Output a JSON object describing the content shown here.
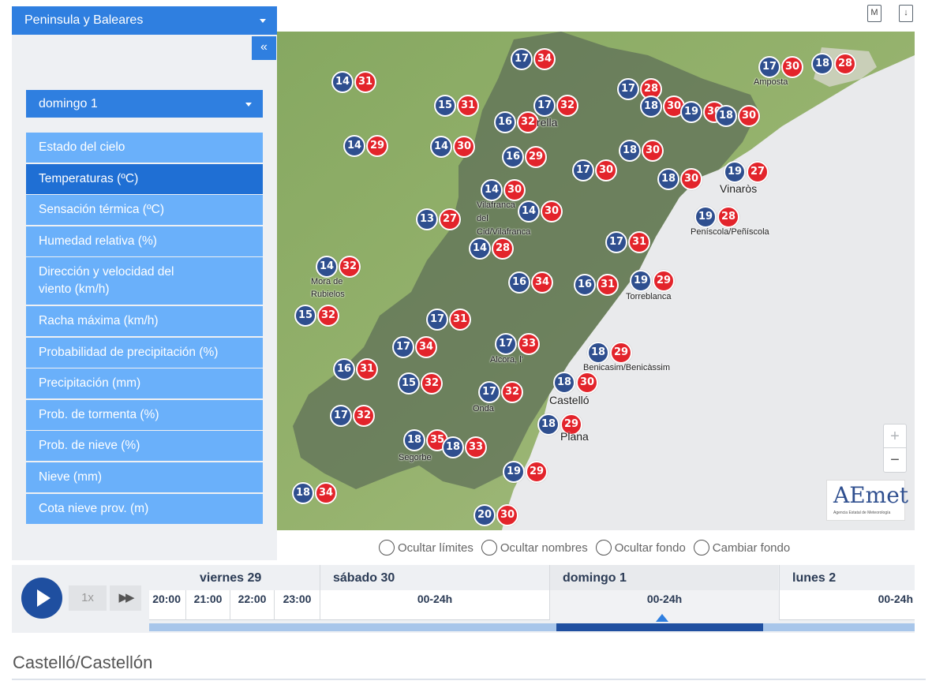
{
  "region_select": {
    "value": "Peninsula y Baleares"
  },
  "collapse_label": "«",
  "day_select": {
    "value": "domingo 1"
  },
  "menu": [
    {
      "label": "Estado del cielo",
      "active": false
    },
    {
      "label": "Temperaturas (ºC)",
      "active": true
    },
    {
      "label": "Sensación térmica (ºC)",
      "active": false
    },
    {
      "label": "Humedad relativa (%)",
      "active": false
    },
    {
      "label": "Dirección y velocidad del viento (km/h)",
      "active": false
    },
    {
      "label": "Racha máxima (km/h)",
      "active": false
    },
    {
      "label": "Probabilidad de precipitación (%)",
      "active": false
    },
    {
      "label": "Precipitación (mm)",
      "active": false
    },
    {
      "label": "Prob. de tormenta (%)",
      "active": false
    },
    {
      "label": "Prob. de nieve (%)",
      "active": false
    },
    {
      "label": "Nieve (mm)",
      "active": false
    },
    {
      "label": "Cota nieve prov. (m)",
      "active": false
    }
  ],
  "top_icons": {
    "map_icon": "M",
    "download_icon": "↓"
  },
  "map": {
    "markers": [
      {
        "min": "17",
        "max": "34"
      },
      {
        "min": "14",
        "max": "31"
      },
      {
        "min": "15",
        "max": "31"
      },
      {
        "min": "17",
        "max": "32"
      },
      {
        "min": "16",
        "max": "32"
      },
      {
        "min": "17",
        "max": "28"
      },
      {
        "min": "18",
        "max": "30"
      },
      {
        "min": "19",
        "max": "30"
      },
      {
        "min": "18",
        "max": "30"
      },
      {
        "min": "17",
        "max": "30"
      },
      {
        "min": "18",
        "max": "28"
      },
      {
        "min": "14",
        "max": "29"
      },
      {
        "min": "14",
        "max": "30"
      },
      {
        "min": "16",
        "max": "29"
      },
      {
        "min": "18",
        "max": "30"
      },
      {
        "min": "17",
        "max": "30"
      },
      {
        "min": "18",
        "max": "30"
      },
      {
        "min": "19",
        "max": "27"
      },
      {
        "min": "14",
        "max": "30"
      },
      {
        "min": "14",
        "max": "30"
      },
      {
        "min": "13",
        "max": "27"
      },
      {
        "min": "19",
        "max": "28"
      },
      {
        "min": "17",
        "max": "31"
      },
      {
        "min": "14",
        "max": "28"
      },
      {
        "min": "14",
        "max": "32"
      },
      {
        "min": "16",
        "max": "34"
      },
      {
        "min": "16",
        "max": "31"
      },
      {
        "min": "19",
        "max": "29"
      },
      {
        "min": "15",
        "max": "32"
      },
      {
        "min": "17",
        "max": "31"
      },
      {
        "min": "17",
        "max": "34"
      },
      {
        "min": "17",
        "max": "33"
      },
      {
        "min": "18",
        "max": "29"
      },
      {
        "min": "16",
        "max": "31"
      },
      {
        "min": "15",
        "max": "32"
      },
      {
        "min": "17",
        "max": "32"
      },
      {
        "min": "18",
        "max": "30"
      },
      {
        "min": "17",
        "max": "32"
      },
      {
        "min": "18",
        "max": "29"
      },
      {
        "min": "18",
        "max": "35"
      },
      {
        "min": "18",
        "max": "33"
      },
      {
        "min": "19",
        "max": "29"
      },
      {
        "min": "18",
        "max": "34"
      },
      {
        "min": "20",
        "max": "30"
      }
    ],
    "places": [
      "Amposta",
      "rella",
      "Vinaròs",
      "Vilafranca",
      "del",
      "Cid/Vilafranca",
      "Peníscola/Peñíscola",
      "Mora de",
      "Rubielos",
      "Torreblanca",
      "Alcora, l'",
      "Benicasim/Benicàssim",
      "Castelló",
      "Onda",
      "Plana",
      "Segorbe"
    ],
    "zoom_in": "+",
    "zoom_out": "−",
    "logo_text": "AEmet",
    "logo_sub": "Agencia Estatal de Meteorología"
  },
  "options": [
    {
      "label": "Ocultar límites"
    },
    {
      "label": "Ocultar nombres"
    },
    {
      "label": "Ocultar fondo"
    },
    {
      "label": "Cambiar fondo"
    }
  ],
  "timeline": {
    "speed": "1x",
    "ff": "▶▶",
    "days": [
      "viernes 29",
      "sábado 30",
      "domingo 1",
      "lunes 2"
    ],
    "hours": [
      "20:00",
      "21:00",
      "22:00",
      "23:00",
      "00-24h",
      "00-24h",
      "00-24h"
    ],
    "progress": {
      "start_fraction": 0.532,
      "end_fraction": 0.802
    },
    "colors": {
      "accent": "#1f4fa0",
      "track": "#a8c6ea"
    }
  },
  "place_title": "Castelló/Castellón",
  "colors": {
    "primary": "#2f7fe0",
    "menu": "#6ab0fa",
    "active": "#1f6fd4",
    "min_temp": "#2f4f8f",
    "max_temp": "#e3242b"
  }
}
